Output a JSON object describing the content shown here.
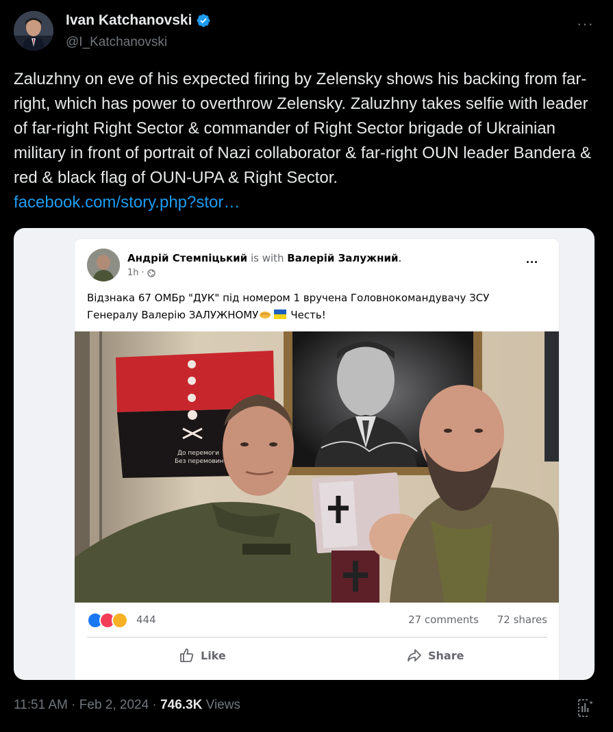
{
  "author": {
    "display_name": "Ivan Katchanovski",
    "handle": "@I_Katchanovski",
    "verified_icon": "verified-badge-icon"
  },
  "tweet": {
    "text": "Zaluzhny on eve of his expected firing by Zelensky shows his backing from far-right, which has power to overthrow Zelensky. Zaluzhny takes selfie with leader of far-right Right Sector & commander of Right Sector brigade of Ukrainian military in front of portrait of Nazi collaborator & far-right OUN leader Bandera & red & black flag of OUN-UPA & Right Sector.",
    "link": "facebook.com/story.php?stor…"
  },
  "fb_post": {
    "author": "Андрій Стемпіцький",
    "with_text": "is with",
    "tagged": "Валерій Залужний",
    "period": ".",
    "time": "1h ·",
    "text_line1": "Відзнака 67 ОМБр \"ДУК\" під номером 1 вручена Головнокомандувачу ЗСУ",
    "text_line2": "Генералу Валерію ЗАЛУЖНОМУ",
    "text_line2_end": "Честь!",
    "flag_text_1": "До перемоги",
    "flag_text_2": "Без перемовин",
    "reaction_count": "444",
    "comments": "27 comments",
    "shares": "72 shares",
    "like_label": "Like",
    "share_label": "Share"
  },
  "footer": {
    "time": "11:51 AM",
    "sep1": "·",
    "date": "Feb 2, 2024",
    "sep2": "·",
    "views_count": "746.3K",
    "views_label": "Views"
  },
  "colors": {
    "background": "#000000",
    "text": "#e7e9ea",
    "muted": "#71767b",
    "link": "#1d9bf0",
    "verified": "#1d9bf0"
  }
}
